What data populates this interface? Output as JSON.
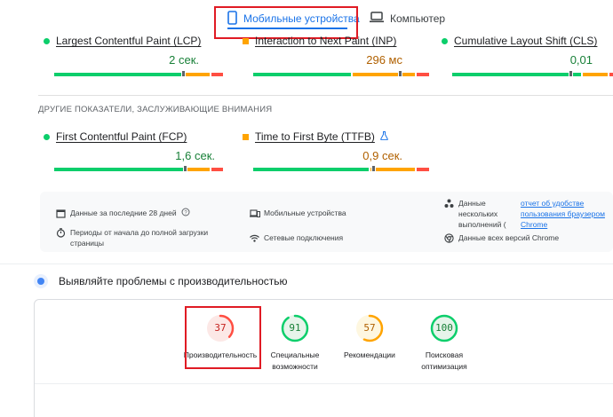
{
  "tabs": {
    "mobile": "Мобильные устройства",
    "desktop": "Компьютер"
  },
  "metrics_top": [
    {
      "name": "Largest Contentful Paint (LCP)",
      "value": "2 сек.",
      "status": "good"
    },
    {
      "name": "Interaction to Next Paint (INP)",
      "value": "296 мс",
      "status": "average"
    },
    {
      "name": "Cumulative Layout Shift (CLS)",
      "value": "0,01",
      "status": "good"
    }
  ],
  "other_metrics_label": "ДРУГИЕ ПОКАЗАТЕЛИ, ЗАСЛУЖИВАЮЩИЕ ВНИМАНИЯ",
  "metrics_other": [
    {
      "name": "First Contentful Paint (FCP)",
      "value": "1,6 сек.",
      "status": "good"
    },
    {
      "name": "Time to First Byte (TTFB)",
      "value": "0,9 сек.",
      "status": "average"
    }
  ],
  "info": {
    "period": "Данные за последние 28 дней",
    "full_load": "Периоды от начала до полной загрузки страницы",
    "devices": "Мобильные устройства",
    "network": "Сетевые подключения",
    "samples": "Данные нескольких выполнений (",
    "chrome_link": "отчет об удобстве пользования браузером Chrome",
    "all_versions": "Данные всех версий Chrome"
  },
  "diagnose": {
    "title": "Выявляйте проблемы с производительностью"
  },
  "scores": [
    {
      "value": "37",
      "label": "Производительность",
      "color": "#ff4e42",
      "bg": "#fce8e6",
      "text": "#c5221f",
      "fraction": 0.37
    },
    {
      "value": "91",
      "label": "Специальные возможности",
      "color": "#0cce6b",
      "bg": "#e6f4ea",
      "text": "#188038",
      "fraction": 0.91
    },
    {
      "value": "57",
      "label": "Рекомендации",
      "color": "#ffa400",
      "bg": "#fef7e0",
      "text": "#b06000",
      "fraction": 0.57
    },
    {
      "value": "100",
      "label": "Поисковая оптимизация",
      "color": "#0cce6b",
      "bg": "#e6f4ea",
      "text": "#188038",
      "fraction": 1.0
    }
  ]
}
